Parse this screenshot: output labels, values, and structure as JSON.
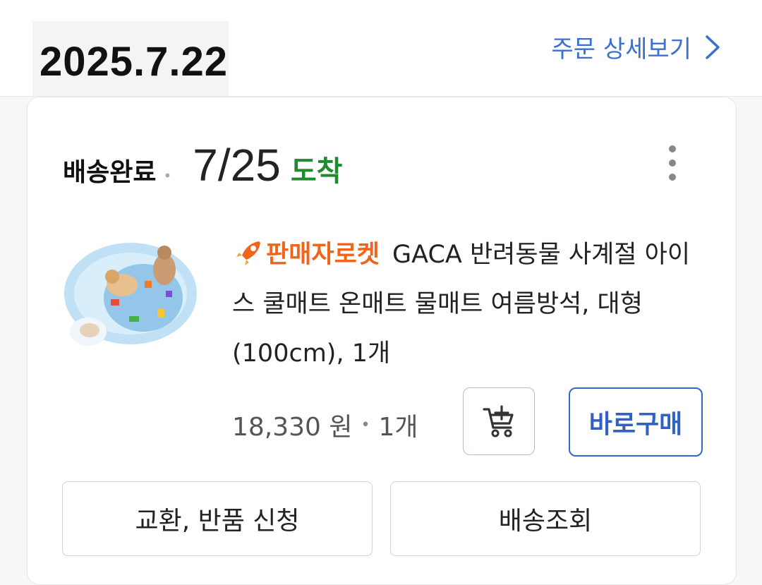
{
  "order": {
    "date": "2025.7.22",
    "detail_link": "주문 상세보기"
  },
  "shipment": {
    "status": "배송완료",
    "arrival_date": "7/25",
    "arrival_label": "도착"
  },
  "product": {
    "badge": "판매자로켓",
    "title": "GACA 반려동물 사계절 아이스 쿨매트 온매트 물매트 여름방석, 대형(100cm), 1개",
    "price": "18,330 원",
    "quantity": "1개",
    "buy_now_label": "바로구매"
  },
  "actions": {
    "exchange_return": "교환, 반품 신청",
    "track_delivery": "배송조회"
  },
  "colors": {
    "link_blue": "#3b6fd0",
    "arrival_green": "#1f8a2e",
    "badge_orange": "#f0641e",
    "buy_blue": "#2f62c4"
  },
  "icons": [
    "chevron-right-icon",
    "more-vertical-icon",
    "rocket-icon",
    "add-to-cart-icon"
  ]
}
